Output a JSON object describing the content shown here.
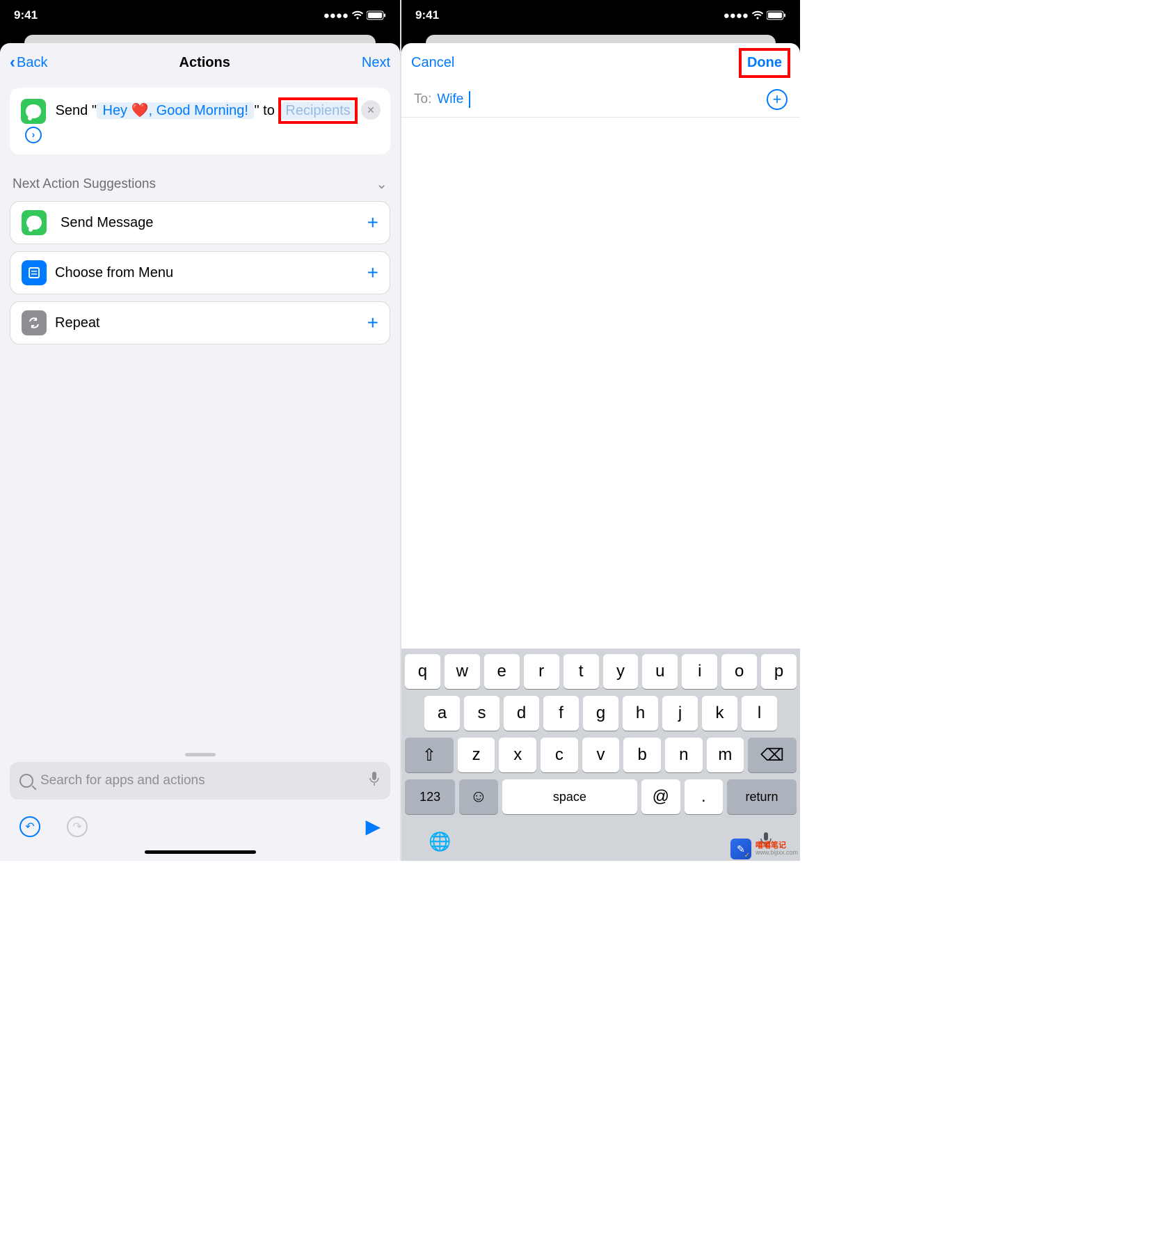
{
  "status": {
    "time": "9:41"
  },
  "left": {
    "nav": {
      "back": "Back",
      "title": "Actions",
      "next": "Next"
    },
    "card": {
      "prefix": "Send \"",
      "message": " Hey ❤️, Good Morning! ",
      "midfix": "\" to ",
      "recipients": "Recipients"
    },
    "suggestions_header": "Next Action Suggestions",
    "suggestions": [
      {
        "label": "Send Message",
        "icon": "message"
      },
      {
        "label": "Choose from Menu",
        "icon": "menu"
      },
      {
        "label": "Repeat",
        "icon": "repeat"
      }
    ],
    "search_placeholder": "Search for apps and actions"
  },
  "right": {
    "cancel": "Cancel",
    "done": "Done",
    "to_label": "To:",
    "to_value": "Wife"
  },
  "keyboard": {
    "row1": [
      "q",
      "w",
      "e",
      "r",
      "t",
      "y",
      "u",
      "i",
      "o",
      "p"
    ],
    "row2": [
      "a",
      "s",
      "d",
      "f",
      "g",
      "h",
      "j",
      "k",
      "l"
    ],
    "row3": [
      "z",
      "x",
      "c",
      "v",
      "b",
      "n",
      "m"
    ],
    "k123": "123",
    "space": "space",
    "at": "@",
    "dot": ".",
    "return": "return"
  },
  "watermark": {
    "text": "嘻嘻笔记",
    "url": "www.bijixx.com"
  }
}
